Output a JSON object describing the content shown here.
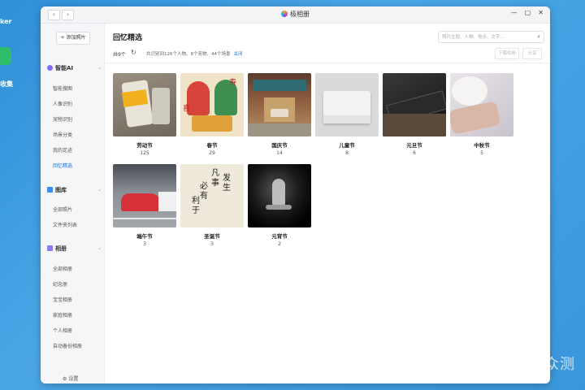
{
  "desktop": {
    "frag1": "ker",
    "frag2": "收集"
  },
  "window": {
    "title": "极相册"
  },
  "sidebar": {
    "add_photo": "+ 添加照片",
    "ai": {
      "title": "智能AI",
      "items": [
        "智能搜图",
        "人像识别",
        "宠物识别",
        "场景分类",
        "我的足迹",
        "回忆精选"
      ]
    },
    "gallery": {
      "title": "图库",
      "items": [
        "全部照片",
        "文件夹列表"
      ]
    },
    "albums": {
      "title": "相册",
      "items": [
        "全部相册",
        "纪念册",
        "宝宝相册",
        "家庭相册",
        "个人相册",
        "自动备份相册"
      ]
    },
    "settings": "设置"
  },
  "main": {
    "title": "回忆精选",
    "search_placeholder": "照片主题、人物、地点、文字...",
    "total": "共9个",
    "summary": "共识别到126个人物、8个宠物、44个场景",
    "close": "关闭",
    "download": "下载相册",
    "share": "分享"
  },
  "cards": [
    {
      "name": "劳动节",
      "count": "125"
    },
    {
      "name": "春节",
      "count": "29"
    },
    {
      "name": "国庆节",
      "count": "14"
    },
    {
      "name": "儿童节",
      "count": "8"
    },
    {
      "name": "元旦节",
      "count": "6"
    },
    {
      "name": "中秋节",
      "count": "5"
    },
    {
      "name": "端午节",
      "count": "3"
    },
    {
      "name": "圣诞节",
      "count": "3"
    },
    {
      "name": "元宵节",
      "count": "2"
    }
  ],
  "watermark": "新浪众测"
}
